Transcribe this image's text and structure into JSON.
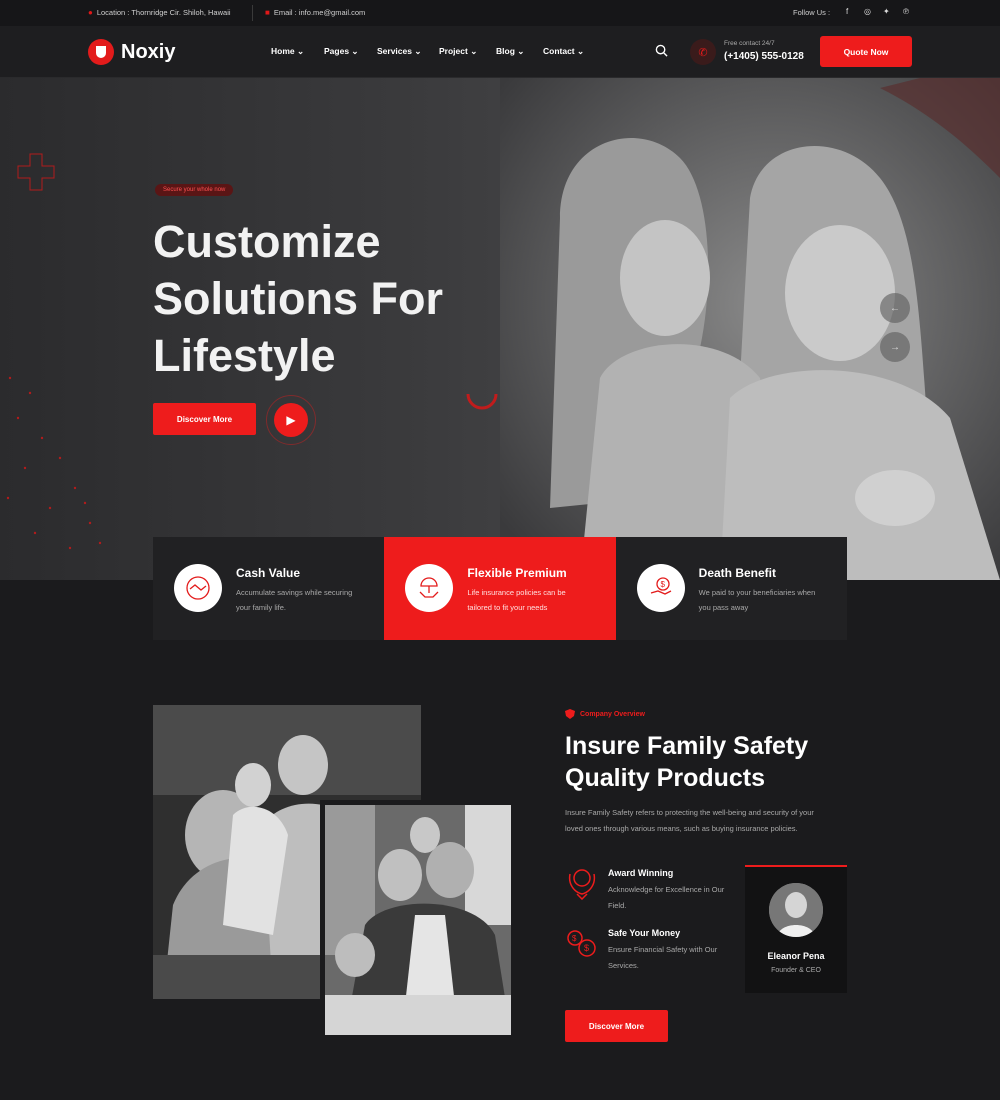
{
  "topbar": {
    "location": "Location : Thornridge Cir. Shiloh, Hawaii",
    "email": "Email : info.me@gmail.com",
    "follow_label": "Follow Us :",
    "socials": [
      "facebook-icon",
      "instagram-icon",
      "twitter-icon",
      "pinterest-icon"
    ]
  },
  "nav": {
    "logo": "Noxiy",
    "menu": [
      "Home",
      "Pages",
      "Services",
      "Project",
      "Blog",
      "Contact"
    ],
    "contact_label": "Free contact 24/7",
    "contact_phone": "(+1405) 555-0128",
    "quote_label": "Quote Now"
  },
  "hero": {
    "tag": "Secure your whole now",
    "title": "Customize Solutions For Lifestyle",
    "button": "Discover More"
  },
  "features": [
    {
      "title": "Cash Value",
      "desc": "Accumulate savings while securing your family life.",
      "icon": "handshake-icon"
    },
    {
      "title": "Flexible Premium",
      "desc": "Life insurance policies can be tailored to fit your needs",
      "icon": "umbrella-hands-icon"
    },
    {
      "title": "Death Benefit",
      "desc": "We paid to your beneficiaries when you pass away",
      "icon": "money-hand-icon"
    }
  ],
  "about": {
    "tag": "Company Overview",
    "title": "Insure Family Safety Quality Products",
    "desc": "Insure Family Safety refers to protecting the well-being and security of your loved ones through various means, such as buying insurance policies.",
    "points": [
      {
        "title": "Award Winning",
        "desc": "Acknowledge for Excellence in Our Field.",
        "icon": "award-icon"
      },
      {
        "title": "Safe Your Money",
        "desc": "Ensure Financial Safety with Our Services.",
        "icon": "money-bags-icon"
      }
    ],
    "button": "Discover More",
    "profile": {
      "name": "Eleanor Pena",
      "role": "Founder & CEO"
    }
  },
  "colors": {
    "accent": "#ee1c1c",
    "background": "#1b1b1d"
  }
}
